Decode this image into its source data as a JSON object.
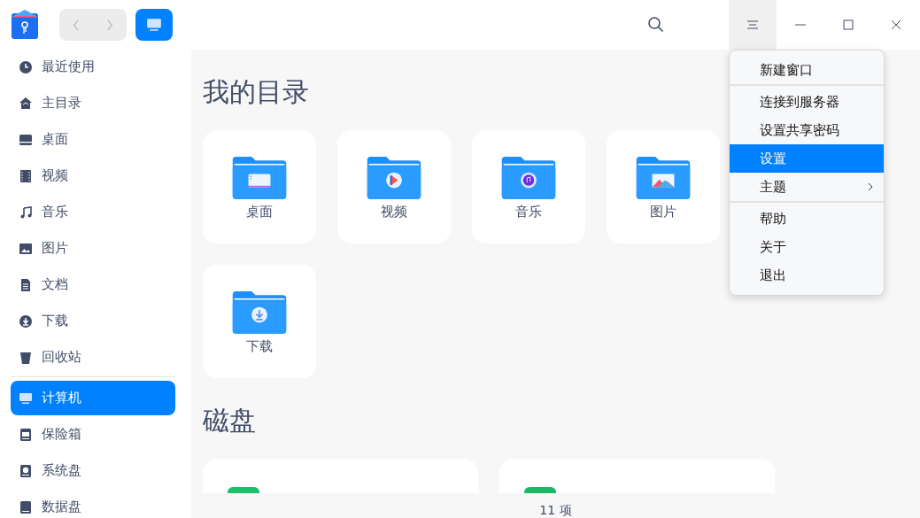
{
  "sidebar": {
    "groups": [
      [
        {
          "label": "最近使用",
          "kind": "clock",
          "selected": false
        },
        {
          "label": "主目录",
          "kind": "home",
          "selected": false
        },
        {
          "label": "桌面",
          "kind": "desktop",
          "selected": false
        },
        {
          "label": "视频",
          "kind": "film",
          "selected": false
        },
        {
          "label": "音乐",
          "kind": "note",
          "selected": false
        },
        {
          "label": "图片",
          "kind": "image",
          "selected": false
        },
        {
          "label": "文档",
          "kind": "doc",
          "selected": false
        },
        {
          "label": "下载",
          "kind": "download",
          "selected": false
        },
        {
          "label": "回收站",
          "kind": "trash",
          "selected": false
        }
      ],
      [
        {
          "label": "计算机",
          "kind": "monitor",
          "selected": true
        },
        {
          "label": "保险箱",
          "kind": "vault",
          "selected": false
        },
        {
          "label": "系统盘",
          "kind": "disk",
          "selected": false
        },
        {
          "label": "数据盘",
          "kind": "drive",
          "selected": false
        }
      ]
    ]
  },
  "sections": [
    {
      "title": "我的目录",
      "folders": [
        {
          "label": "桌面",
          "kind": "desktop"
        },
        {
          "label": "视频",
          "kind": "video"
        },
        {
          "label": "音乐",
          "kind": "music"
        },
        {
          "label": "图片",
          "kind": "picture"
        },
        {
          "label": "下载",
          "kind": "download"
        }
      ]
    },
    {
      "title": "磁盘",
      "disks": [
        {
          "kind": "system"
        },
        {
          "kind": "data"
        }
      ]
    }
  ],
  "menu": {
    "items": [
      {
        "label": "新建窗口",
        "selected": false,
        "submenu": false,
        "divider_after": true
      },
      {
        "label": "连接到服务器",
        "selected": false,
        "submenu": false,
        "divider_after": false
      },
      {
        "label": "设置共享密码",
        "selected": false,
        "submenu": false,
        "divider_after": false
      },
      {
        "label": "设置",
        "selected": true,
        "submenu": false,
        "divider_after": false
      },
      {
        "label": "主题",
        "selected": false,
        "submenu": true,
        "divider_after": true
      },
      {
        "label": "帮助",
        "selected": false,
        "submenu": false,
        "divider_after": false
      },
      {
        "label": "关于",
        "selected": false,
        "submenu": false,
        "divider_after": false
      },
      {
        "label": "退出",
        "selected": false,
        "submenu": false,
        "divider_after": false
      }
    ]
  },
  "status_bar": {
    "count": "11 项"
  }
}
